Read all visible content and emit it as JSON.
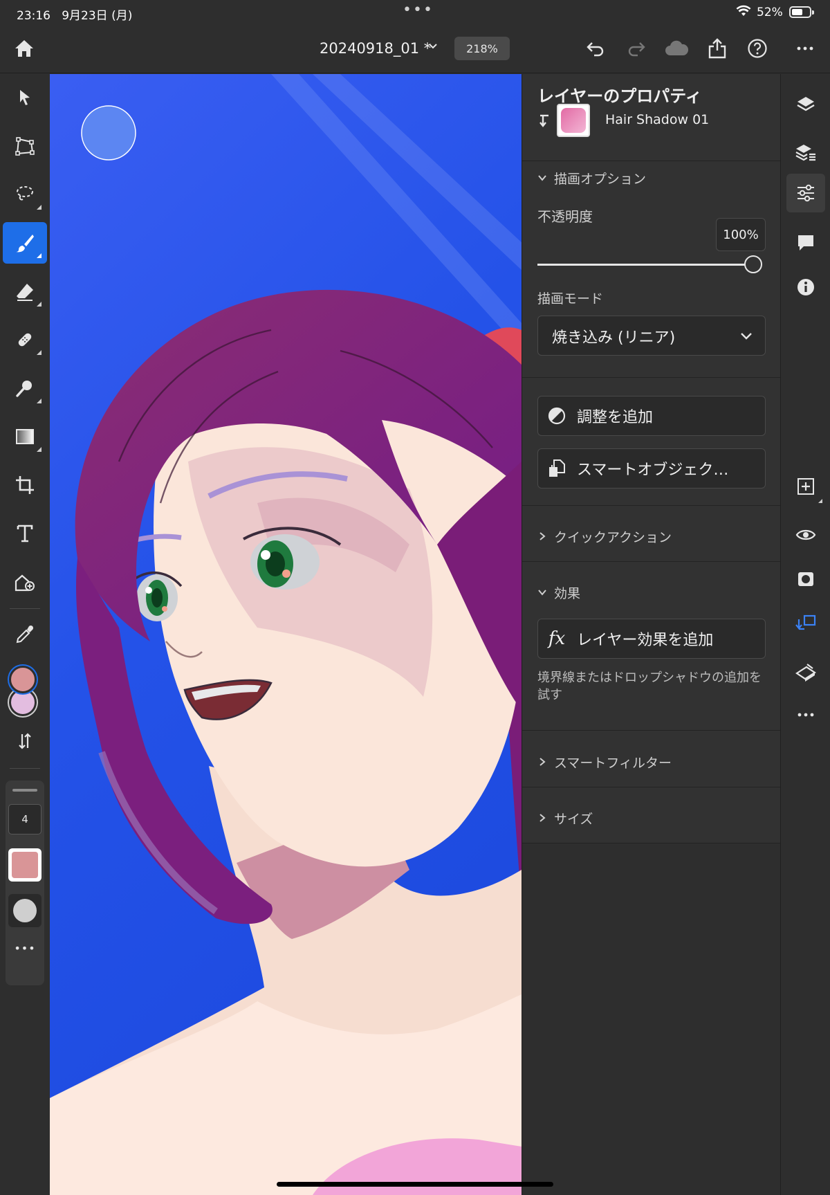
{
  "status_bar": {
    "time": "23:16",
    "date": "9月23日 (月)",
    "more": "•••",
    "battery": "52%",
    "battery_level": 0.52
  },
  "top_bar": {
    "home_icon": "home-icon",
    "document_title": "20240918_01 *",
    "zoom": "218%",
    "actions": [
      "undo-icon",
      "redo-icon",
      "cloud-icon",
      "share-icon",
      "help-icon",
      "more-icon"
    ]
  },
  "left_toolbar": {
    "tools": [
      "select-icon",
      "transform-icon",
      "lasso-icon",
      "brush-icon",
      "eraser-icon",
      "healing-icon",
      "smudge-icon",
      "gradient-icon",
      "crop-icon",
      "type-icon",
      "place-image-icon",
      "eyedropper-icon"
    ],
    "active_tool": "brush-icon",
    "foreground_color": "#d99597",
    "background_color": "#e3bde0",
    "brush_size": "4",
    "brush_color": "#d99597",
    "brush_tip": "#cfcfcf",
    "more": "•••"
  },
  "panel": {
    "title": "レイヤーのプロパティ",
    "layer_name": "Hair Shadow 01",
    "sections": {
      "draw_options": "描画オプション",
      "quick_actions": "クイックアクション",
      "effects": "効果",
      "smart_filters": "スマートフィルター",
      "size": "サイズ"
    },
    "opacity_label": "不透明度",
    "opacity_value": "100%",
    "opacity_level": 1.0,
    "blend_mode_label": "描画モード",
    "blend_mode_value": "焼き込み (リニア)",
    "add_adjustment": "調整を追加",
    "smart_object": "スマートオブジェク…",
    "add_layer_effect": "レイヤー効果を追加",
    "fx_label": "fx",
    "effect_hint": "境界線またはドロップシャドウの追加を試す"
  },
  "right_rail": {
    "icons": [
      "layers-icon",
      "layer-stack-icon",
      "properties-icon",
      "comments-icon",
      "info-icon",
      "add-layer-icon",
      "visibility-icon",
      "mask-icon",
      "clipping-icon",
      "fill-layer-icon",
      "more-icon"
    ],
    "more": "•••"
  }
}
